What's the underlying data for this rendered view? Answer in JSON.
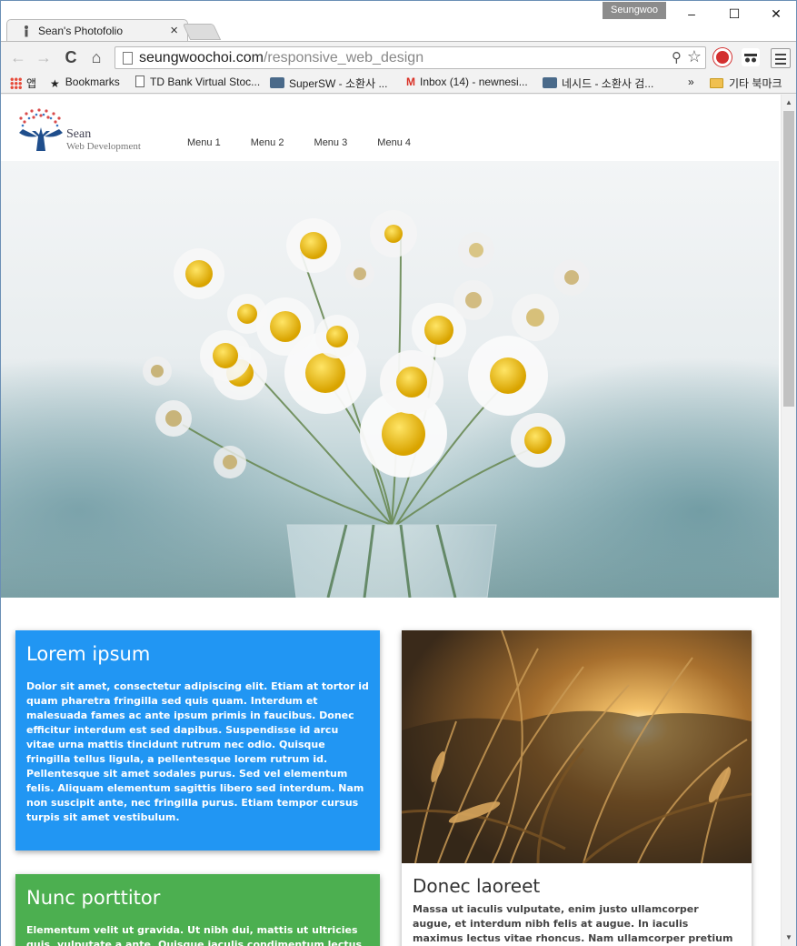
{
  "browser": {
    "tab_title": "Sean's Photofolio",
    "tab_close": "×",
    "profile_name": "Seungwoo",
    "window_controls": {
      "minimize": "–",
      "maximize": "☐",
      "close": "✕"
    },
    "url_host": "seungwoochoi.com",
    "url_path": "/responsive_web_design",
    "icons": {
      "back": "←",
      "forward": "→",
      "reload": "C",
      "home": "⌂",
      "zoom": "⚲",
      "star": "☆"
    }
  },
  "bookmarks": {
    "items": [
      {
        "label": "앱",
        "icon": "apps-grid"
      },
      {
        "label": "Bookmarks",
        "icon": "star"
      },
      {
        "label": "TD Bank Virtual Stoc...",
        "icon": "page"
      },
      {
        "label": "SuperSW - 소환사 ...",
        "icon": "opgg"
      },
      {
        "label": "Inbox (14) - newnesi...",
        "icon": "gmail"
      },
      {
        "label": "네시드 - 소환사 검...",
        "icon": "opgg"
      }
    ],
    "overflow": "»",
    "other_folder": "기타 북마크"
  },
  "site": {
    "logo_name": "Sean",
    "logo_subtitle": "Web Development",
    "nav": [
      "Menu 1",
      "Menu 2",
      "Menu 3",
      "Menu 4"
    ]
  },
  "cards": {
    "blue": {
      "title": "Lorem ipsum",
      "text": "Dolor sit amet, consectetur adipiscing elit. Etiam at tortor id quam pharetra fringilla sed quis quam. Interdum et malesuada fames ac ante ipsum primis in faucibus. Donec efficitur interdum est sed dapibus. Suspendisse id arcu vitae urna mattis tincidunt rutrum nec odio. Quisque fringilla tellus ligula, a pellentesque lorem rutrum id. Pellentesque sit amet sodales purus. Sed vel elementum felis. Aliquam elementum sagittis libero sed interdum. Nam non suscipit ante, nec fringilla purus. Etiam tempor cursus turpis sit amet vestibulum.",
      "color": "#2196f3"
    },
    "green": {
      "title": "Nunc porttitor",
      "text": "Elementum velit ut gravida. Ut nibh dui, mattis ut ultricies quis, vulputate a ante. Quisque iaculis condimentum lectus eu",
      "color": "#4caf50"
    },
    "photo": {
      "title": "Donec laoreet",
      "text": "Massa ut iaculis vulputate, enim justo ullamcorper augue, et interdum nibh felis at augue. In iaculis maximus lectus vitae rhoncus. Nam ullamcorper pretium consequat. Integer"
    }
  }
}
